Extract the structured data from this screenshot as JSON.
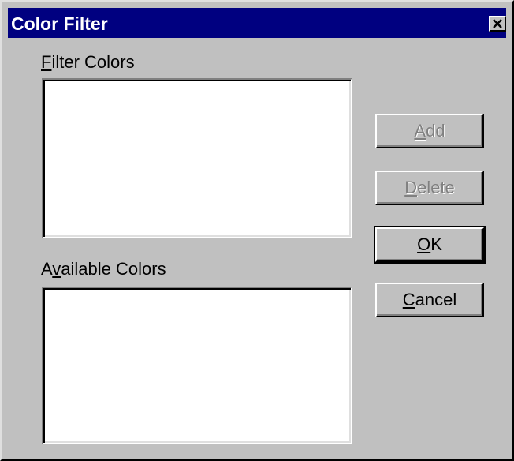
{
  "window": {
    "title": "Color Filter"
  },
  "labels": {
    "filter_colors": "Filter Colors",
    "available_colors": "Available Colors"
  },
  "buttons": {
    "add": "Add",
    "delete": "Delete",
    "ok": "OK",
    "cancel": "Cancel"
  },
  "icons": {
    "close": "close-icon"
  },
  "colors": {
    "titlebar": "#000080",
    "dialog_face": "#c0c0c0",
    "listbox_bg": "#ffffff",
    "disabled_text": "#808080"
  },
  "state": {
    "add_enabled": false,
    "delete_enabled": false,
    "default_button": "OK"
  }
}
